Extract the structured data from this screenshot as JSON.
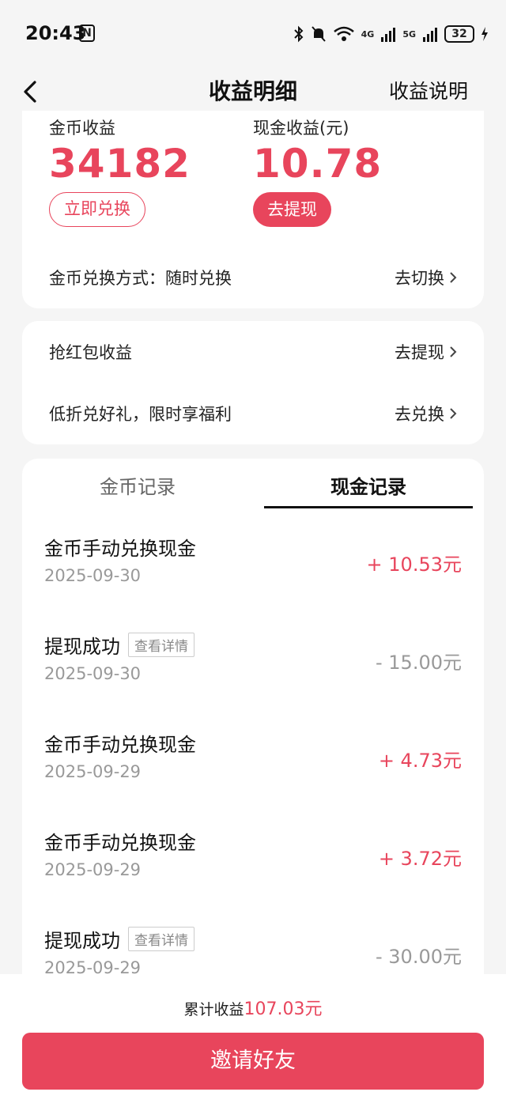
{
  "status_bar": {
    "time": "20:43",
    "nfc": "N",
    "network_1": "4G",
    "network_2": "5G",
    "battery": "32"
  },
  "header": {
    "title": "收益明细",
    "help_link": "收益说明"
  },
  "summary": {
    "coin_label": "金币收益",
    "coin_value": "34182",
    "coin_button": "立即兑换",
    "cash_label": "现金收益(元)",
    "cash_value": "10.78",
    "cash_button": "去提现",
    "exchange_mode_label": "金币兑换方式：随时兑换",
    "exchange_mode_link": "去切换"
  },
  "links": [
    {
      "label": "抢红包收益",
      "action": "去提现"
    },
    {
      "label": "低折兑好礼，限时享福利",
      "action": "去兑换"
    }
  ],
  "tabs": {
    "coin": "金币记录",
    "cash": "现金记录",
    "active": "cash"
  },
  "records": [
    {
      "title": "金币手动兑换现金",
      "date": "2025-09-30",
      "amount": "+ 10.53元",
      "positive": true
    },
    {
      "title": "提现成功",
      "tag": "查看详情",
      "date": "2025-09-30",
      "amount": "- 15.00元",
      "positive": false
    },
    {
      "title": "金币手动兑换现金",
      "date": "2025-09-29",
      "amount": "+ 4.73元",
      "positive": true
    },
    {
      "title": "金币手动兑换现金",
      "date": "2025-09-29",
      "amount": "+ 3.72元",
      "positive": true
    },
    {
      "title": "提现成功",
      "tag": "查看详情",
      "date": "2025-09-29",
      "amount": "- 30.00元",
      "positive": false
    }
  ],
  "footer": {
    "total_label": "累计收益",
    "total_value": "107.03元",
    "invite_button": "邀请好友"
  },
  "colors": {
    "accent": "#e8455c",
    "background": "#f5f5f5"
  }
}
